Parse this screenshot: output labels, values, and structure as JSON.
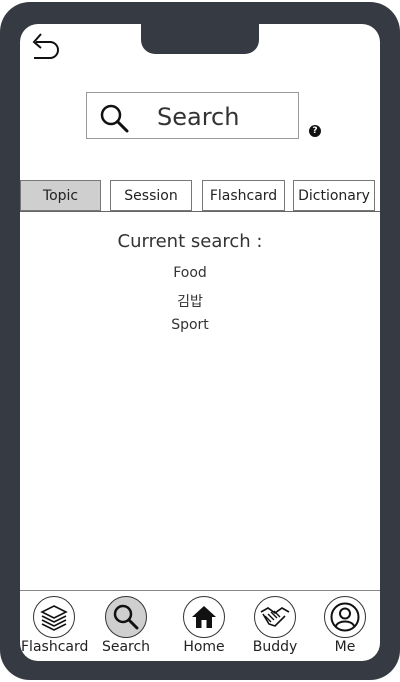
{
  "search": {
    "placeholder": "Search",
    "help_glyph": "?"
  },
  "tabs": [
    {
      "label": "Topic",
      "active": true
    },
    {
      "label": "Session",
      "active": false
    },
    {
      "label": "Flashcard",
      "active": false
    },
    {
      "label": "Dictionary",
      "active": false
    }
  ],
  "current_search": {
    "heading": "Current search :",
    "items": [
      "Food",
      "김밥",
      "Sport"
    ]
  },
  "nav": [
    {
      "label": "Flashcard",
      "icon": "layers-icon"
    },
    {
      "label": "Search",
      "icon": "search-icon",
      "active": true
    },
    {
      "label": "Home",
      "icon": "home-icon"
    },
    {
      "label": "Buddy",
      "icon": "handshake-icon"
    },
    {
      "label": "Me",
      "icon": "user-icon"
    }
  ],
  "colors": {
    "frame": "#353a43",
    "active_tab": "#cfcfcf",
    "active_nav": "#cfcfcf"
  }
}
